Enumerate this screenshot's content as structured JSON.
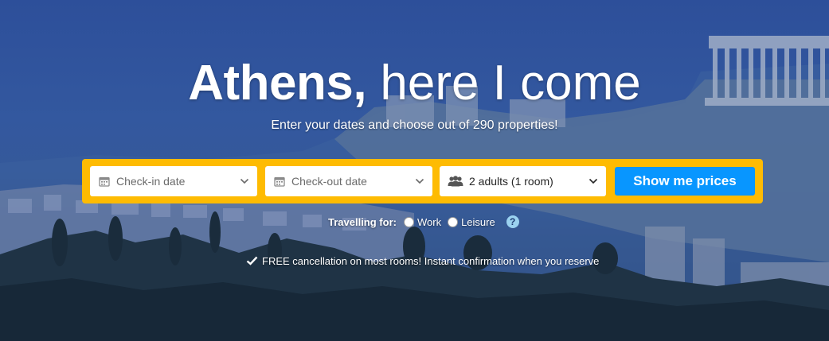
{
  "hero": {
    "title_city": "Athens,",
    "title_rest": " here I come",
    "subtitle": "Enter your dates and choose out of 290 properties!"
  },
  "search": {
    "checkin_label": "Check-in date",
    "checkout_label": "Check-out date",
    "guests_label": "2 adults (1 room)",
    "submit_label": "Show me prices"
  },
  "travelling": {
    "label": "Travelling for:",
    "options": [
      "Work",
      "Leisure"
    ],
    "help": "?"
  },
  "notice": {
    "text": "FREE cancellation on most rooms! Instant confirmation when you reserve"
  },
  "colors": {
    "searchbar": "#febb02",
    "button": "#0896ff",
    "sky": "#2d4f9a"
  },
  "icons": {
    "checkin": "calendar-icon",
    "checkout": "calendar-icon",
    "guests": "people-icon",
    "dropdown": "chevron-down-icon",
    "help": "question-circle-icon",
    "notice": "checkmark-icon"
  }
}
